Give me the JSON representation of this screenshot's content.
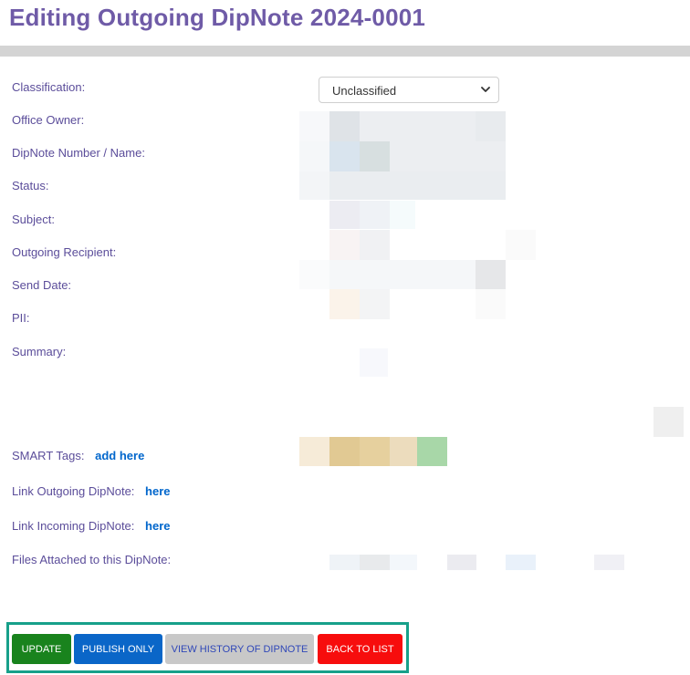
{
  "page": {
    "title": "Editing Outgoing DipNote 2024-0001"
  },
  "form": {
    "labels": {
      "classification": "Classification:",
      "office_owner": "Office Owner:",
      "dipnote_number": "DipNote Number / Name:",
      "status": "Status:",
      "subject": "Subject:",
      "outgoing_recipient": "Outgoing Recipient:",
      "send_date": "Send Date:",
      "pii": "PII:",
      "summary": "Summary:",
      "smart_tags": "SMART Tags:",
      "link_outgoing": "Link Outgoing DipNote:",
      "link_incoming": "Link Incoming DipNote:",
      "files_attached": "Files Attached to this DipNote:"
    },
    "classification_value": "Unclassified",
    "links": {
      "smart_tags_add": "add here",
      "link_outgoing_here": "here",
      "link_incoming_here": "here"
    }
  },
  "buttons": {
    "update": "UPDATE",
    "publish_only": "PUBLISH ONLY",
    "view_history": "VIEW HISTORY OF DIPNOTE",
    "back_to_list": "BACK TO LIST"
  },
  "colors": {
    "title": "#6f5ba7",
    "label": "#5b4d9a",
    "link": "#0066cc",
    "update": "#19831d",
    "publish": "#0a66c8",
    "history": "#c8c8c8",
    "back": "#f70d0d",
    "frame": "#17a08a"
  }
}
